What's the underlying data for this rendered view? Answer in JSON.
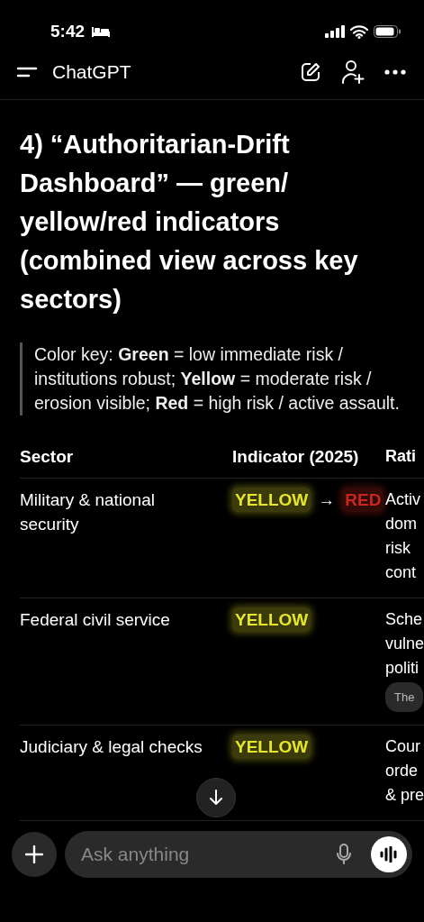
{
  "status_bar": {
    "time": "5:42"
  },
  "header": {
    "title": "ChatGPT"
  },
  "heading": "4) “Authoritarian-Drift Dashboard” — green/ yellow/red indicators (combined view across key sectors)",
  "color_key": "Color key: **Green** = low immediate risk / institutions robust; **Yellow** = moderate risk / erosion visible; **Red** = high risk / active assault.",
  "table": {
    "columns": [
      "Sector",
      "Indicator (2025)",
      "Rati"
    ],
    "rows": [
      {
        "sector": "Military & national security",
        "indicator": [
          {
            "kind": "level",
            "text": "YELLOW",
            "color": "#e6e62a"
          },
          {
            "kind": "arrow",
            "text": "→"
          },
          {
            "kind": "level",
            "text": "RED",
            "color": "#c8261e"
          }
        ],
        "rationale": [
          "Activ",
          "dom",
          "risk",
          "cont"
        ]
      },
      {
        "sector": "Federal civil service",
        "indicator": [
          {
            "kind": "level",
            "text": "YELLOW",
            "color": "#e6e62a"
          }
        ],
        "rationale": [
          "Sche",
          "vulne",
          "politi"
        ],
        "source": "The"
      },
      {
        "sector": "Judiciary & legal checks",
        "indicator": [
          {
            "kind": "level",
            "text": "YELLOW",
            "color": "#e6e62a"
          }
        ],
        "rationale": [
          "Cour",
          "orde",
          "& pre"
        ]
      }
    ]
  },
  "composer": {
    "placeholder": "Ask anything"
  }
}
